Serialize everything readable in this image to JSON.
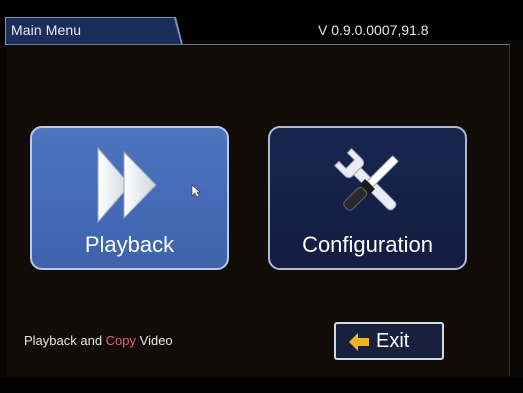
{
  "header": {
    "title": "Main Menu",
    "version": "V 0.9.0.0007,91.8"
  },
  "menu": {
    "playback_label": "Playback",
    "configuration_label": "Configuration"
  },
  "status": {
    "text_before": "Playback and ",
    "text_accent": "Copy",
    "text_after": " Video"
  },
  "exit": {
    "label": "Exit"
  },
  "colors": {
    "playback_tile": "#4d74bf",
    "config_tile": "#18264e",
    "exit_arrow": "#f5b323",
    "status_accent": "#e06666"
  },
  "icons": {
    "playback": "fast-forward-icon",
    "configuration": "wrench-screwdriver-icon",
    "exit": "arrow-left-icon",
    "pointer": "mouse-cursor-icon"
  }
}
